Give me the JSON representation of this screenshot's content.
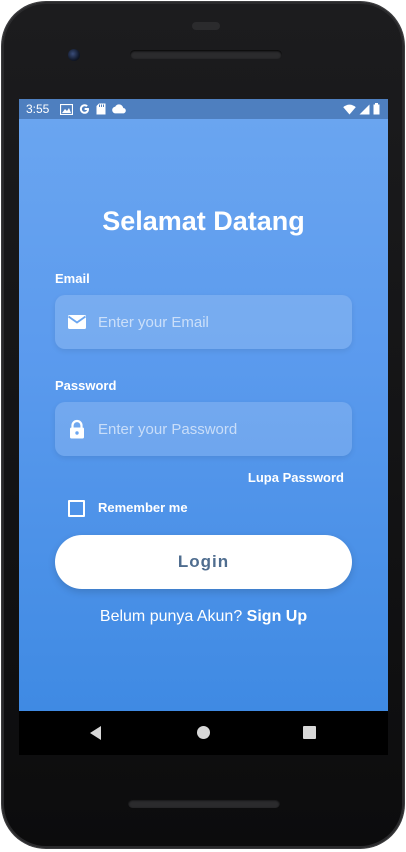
{
  "status_bar": {
    "time": "3:55",
    "left_icons": [
      "image-icon",
      "google-icon",
      "sd-card-icon",
      "cloud-icon"
    ],
    "right_icons": [
      "wifi-icon",
      "signal-icon",
      "battery-icon"
    ]
  },
  "login": {
    "title": "Selamat Datang",
    "email_label": "Email",
    "email_placeholder": "Enter your Email",
    "email_icon": "mail-icon",
    "password_label": "Password",
    "password_placeholder": "Enter your Password",
    "password_icon": "lock-icon",
    "forgot_password": "Lupa Password",
    "remember_me": "Remember me",
    "remember_checked": false,
    "login_button": "Login",
    "signup_prompt": "Belum punya Akun?",
    "signup_link": "Sign Up"
  },
  "nav_bar": {
    "icons": [
      "back-icon",
      "home-icon",
      "recents-icon"
    ]
  },
  "colors": {
    "gradient_top": "#6ba6f0",
    "gradient_bottom": "#3f8ae3",
    "status_bar": "#4e7fbf",
    "button_text": "#4f6d8f"
  }
}
